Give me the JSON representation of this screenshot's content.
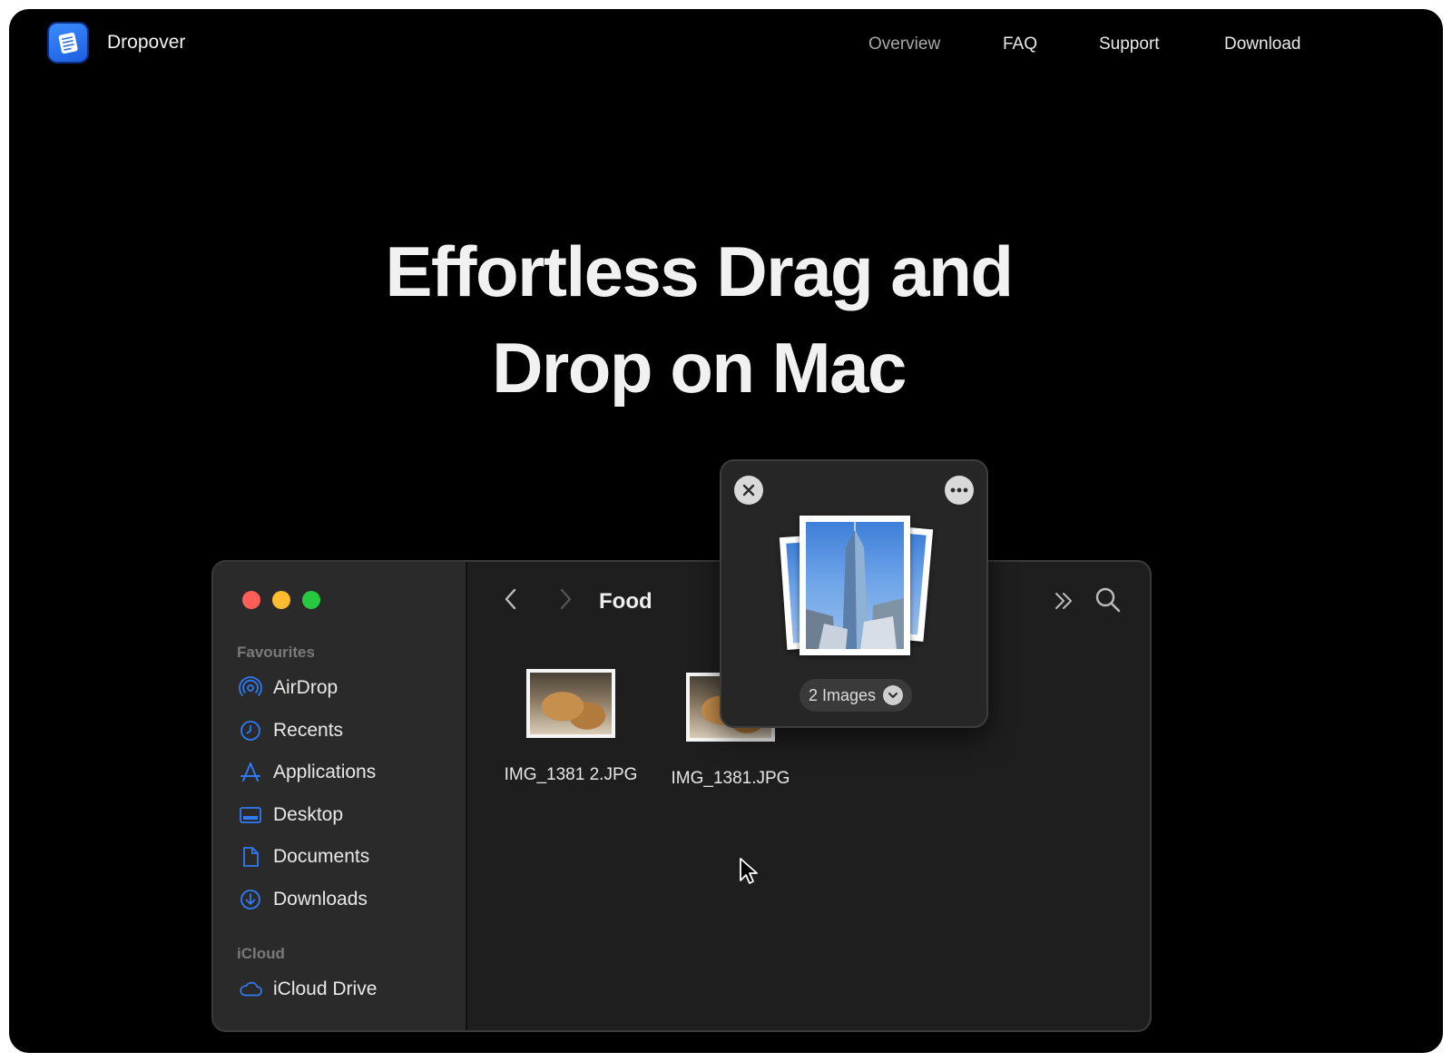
{
  "header": {
    "brand_name": "Dropover",
    "nav": [
      {
        "label": "Overview",
        "active": true
      },
      {
        "label": "FAQ",
        "active": false
      },
      {
        "label": "Support",
        "active": false
      },
      {
        "label": "Download",
        "active": false
      }
    ]
  },
  "hero": {
    "line1": "Effortless Drag and",
    "line2": "Drop on Mac"
  },
  "finder": {
    "folder_title": "Food",
    "sidebar": {
      "favourites_label": "Favourites",
      "favourites": [
        {
          "label": "AirDrop",
          "icon": "airdrop-icon"
        },
        {
          "label": "Recents",
          "icon": "clock-icon"
        },
        {
          "label": "Applications",
          "icon": "applications-icon"
        },
        {
          "label": "Desktop",
          "icon": "desktop-icon"
        },
        {
          "label": "Documents",
          "icon": "document-icon"
        },
        {
          "label": "Downloads",
          "icon": "download-icon"
        }
      ],
      "icloud_label": "iCloud",
      "icloud": [
        {
          "label": "iCloud Drive",
          "icon": "cloud-icon"
        }
      ]
    },
    "files": [
      {
        "name": "IMG_1381 2.JPG"
      },
      {
        "name": "IMG_1381.JPG"
      }
    ]
  },
  "shelf": {
    "count_label": "2 Images"
  },
  "colors": {
    "background": "#000000",
    "accent": "#2f7bf5",
    "traffic_red": "#ff5f57",
    "traffic_yellow": "#febc2e",
    "traffic_green": "#28c840"
  }
}
